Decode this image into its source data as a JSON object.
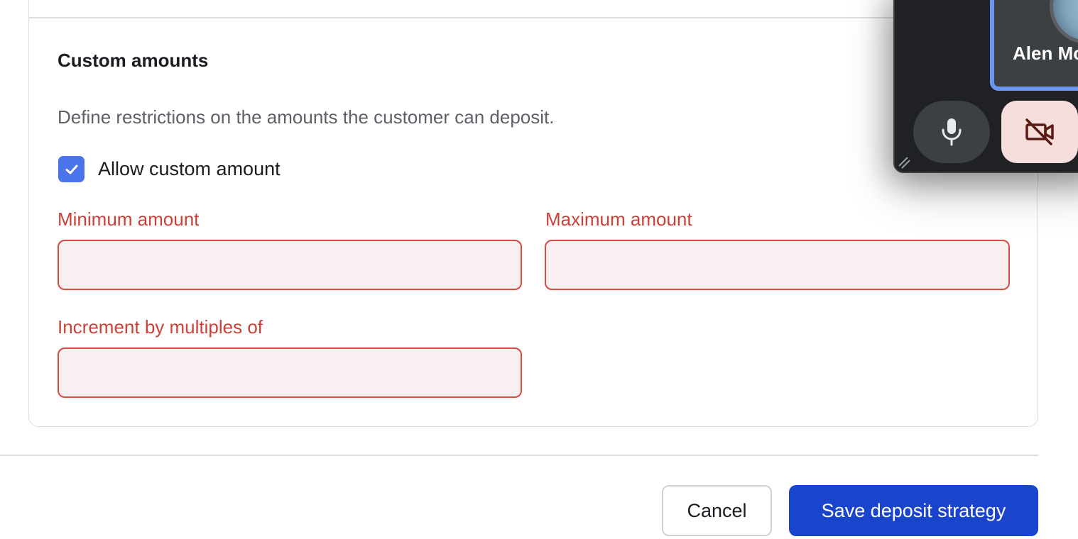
{
  "section": {
    "title": "Custom amounts",
    "description": "Define restrictions on the amounts the customer can deposit."
  },
  "allow_custom": {
    "label": "Allow custom amount",
    "checked": true
  },
  "fields": {
    "minimum": {
      "label": "Minimum amount",
      "value": "",
      "placeholder": ""
    },
    "maximum": {
      "label": "Maximum amount",
      "value": "",
      "placeholder": ""
    },
    "increment": {
      "label": "Increment by multiples of",
      "value": "",
      "placeholder": ""
    }
  },
  "footer": {
    "cancel_label": "Cancel",
    "save_label": "Save deposit strategy"
  },
  "video_call": {
    "participant_name": "Alen Mc",
    "mic_icon": "microphone-icon",
    "camera_icon": "video-off-icon"
  },
  "colors": {
    "error": "#c94239",
    "error_fill": "#f9eff0",
    "checkbox": "#4b73ea",
    "primary": "#1b44cc",
    "active_tile_border": "#6b96f2"
  }
}
